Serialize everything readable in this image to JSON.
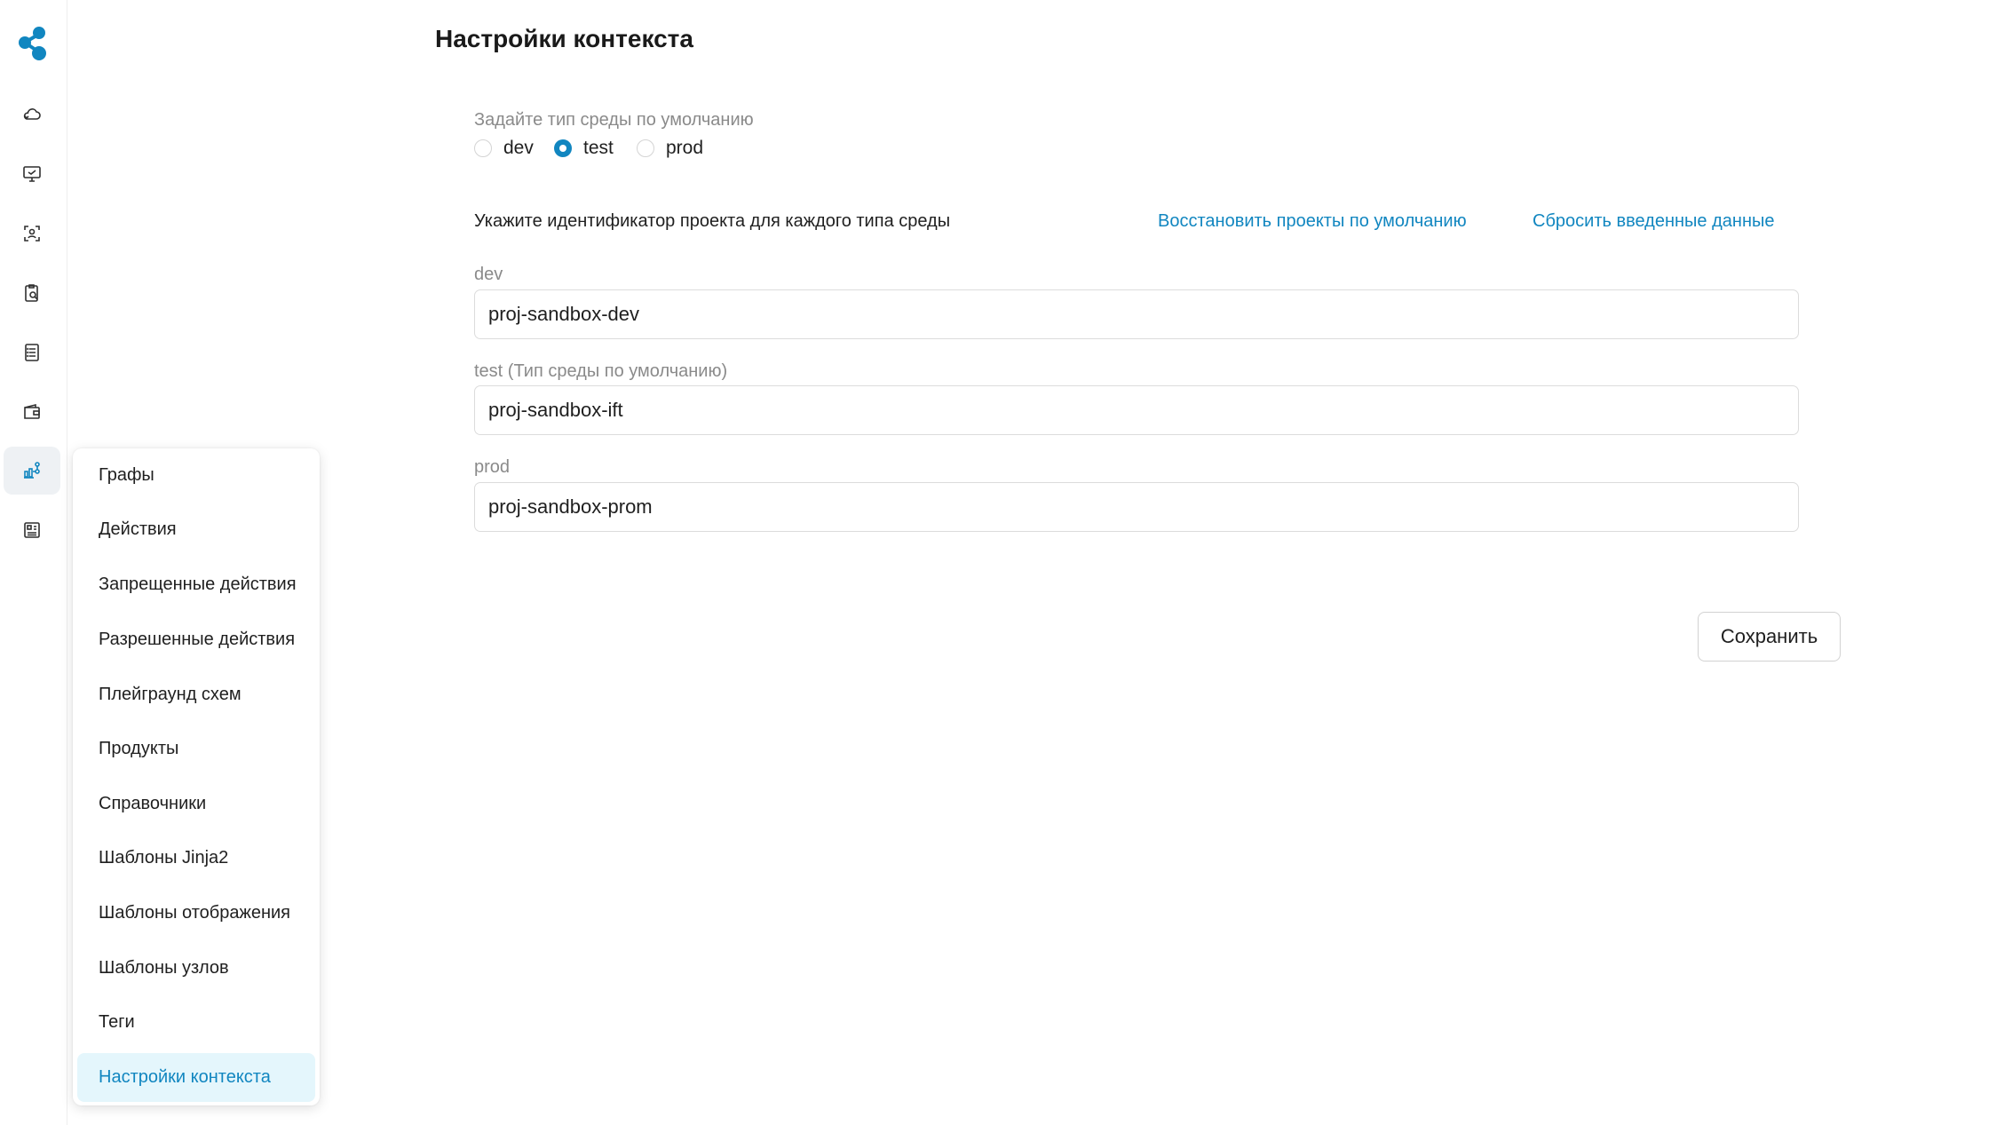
{
  "app": {
    "accent_color": "#1186c0",
    "logo_icon": "app-logo-icon"
  },
  "rail": {
    "items": [
      {
        "icon": "cloud-icon",
        "active": false
      },
      {
        "icon": "monitor-icon",
        "active": false
      },
      {
        "icon": "scan-person-icon",
        "active": false
      },
      {
        "icon": "clipboard-search-icon",
        "active": false
      },
      {
        "icon": "list-document-icon",
        "active": false
      },
      {
        "icon": "wallet-icon",
        "active": false
      },
      {
        "icon": "graph-nodes-icon",
        "active": true
      },
      {
        "icon": "dashboard-report-icon",
        "active": false
      }
    ]
  },
  "menu": {
    "items": [
      {
        "label": "Графы"
      },
      {
        "label": "Действия"
      },
      {
        "label": "Запрещенные действия"
      },
      {
        "label": "Разрешенные действия"
      },
      {
        "label": "Плейграунд схем"
      },
      {
        "label": "Продукты"
      },
      {
        "label": "Справочники"
      },
      {
        "label": "Шаблоны Jinja2"
      },
      {
        "label": "Шаблоны отображения"
      },
      {
        "label": "Шаблоны узлов"
      },
      {
        "label": "Теги"
      },
      {
        "label": "Настройки контекста",
        "active": true
      }
    ]
  },
  "page": {
    "title": "Настройки контекста",
    "env_type_label": "Задайте тип среды по умолчанию",
    "env_types": [
      {
        "label": "dev",
        "checked": false
      },
      {
        "label": "test",
        "checked": true
      },
      {
        "label": "prod",
        "checked": false
      }
    ],
    "project_hint": "Укажите идентификатор проекта для каждого типа среды",
    "restore_link": "Восстановить проекты по умолчанию",
    "reset_link": "Сбросить введенные данные",
    "fields": [
      {
        "label": "dev",
        "value": "proj-sandbox-dev"
      },
      {
        "label": "test (Тип среды по умолчанию)",
        "value": "proj-sandbox-ift"
      },
      {
        "label": "prod",
        "value": "proj-sandbox-prom"
      }
    ],
    "save_label": "Сохранить"
  }
}
